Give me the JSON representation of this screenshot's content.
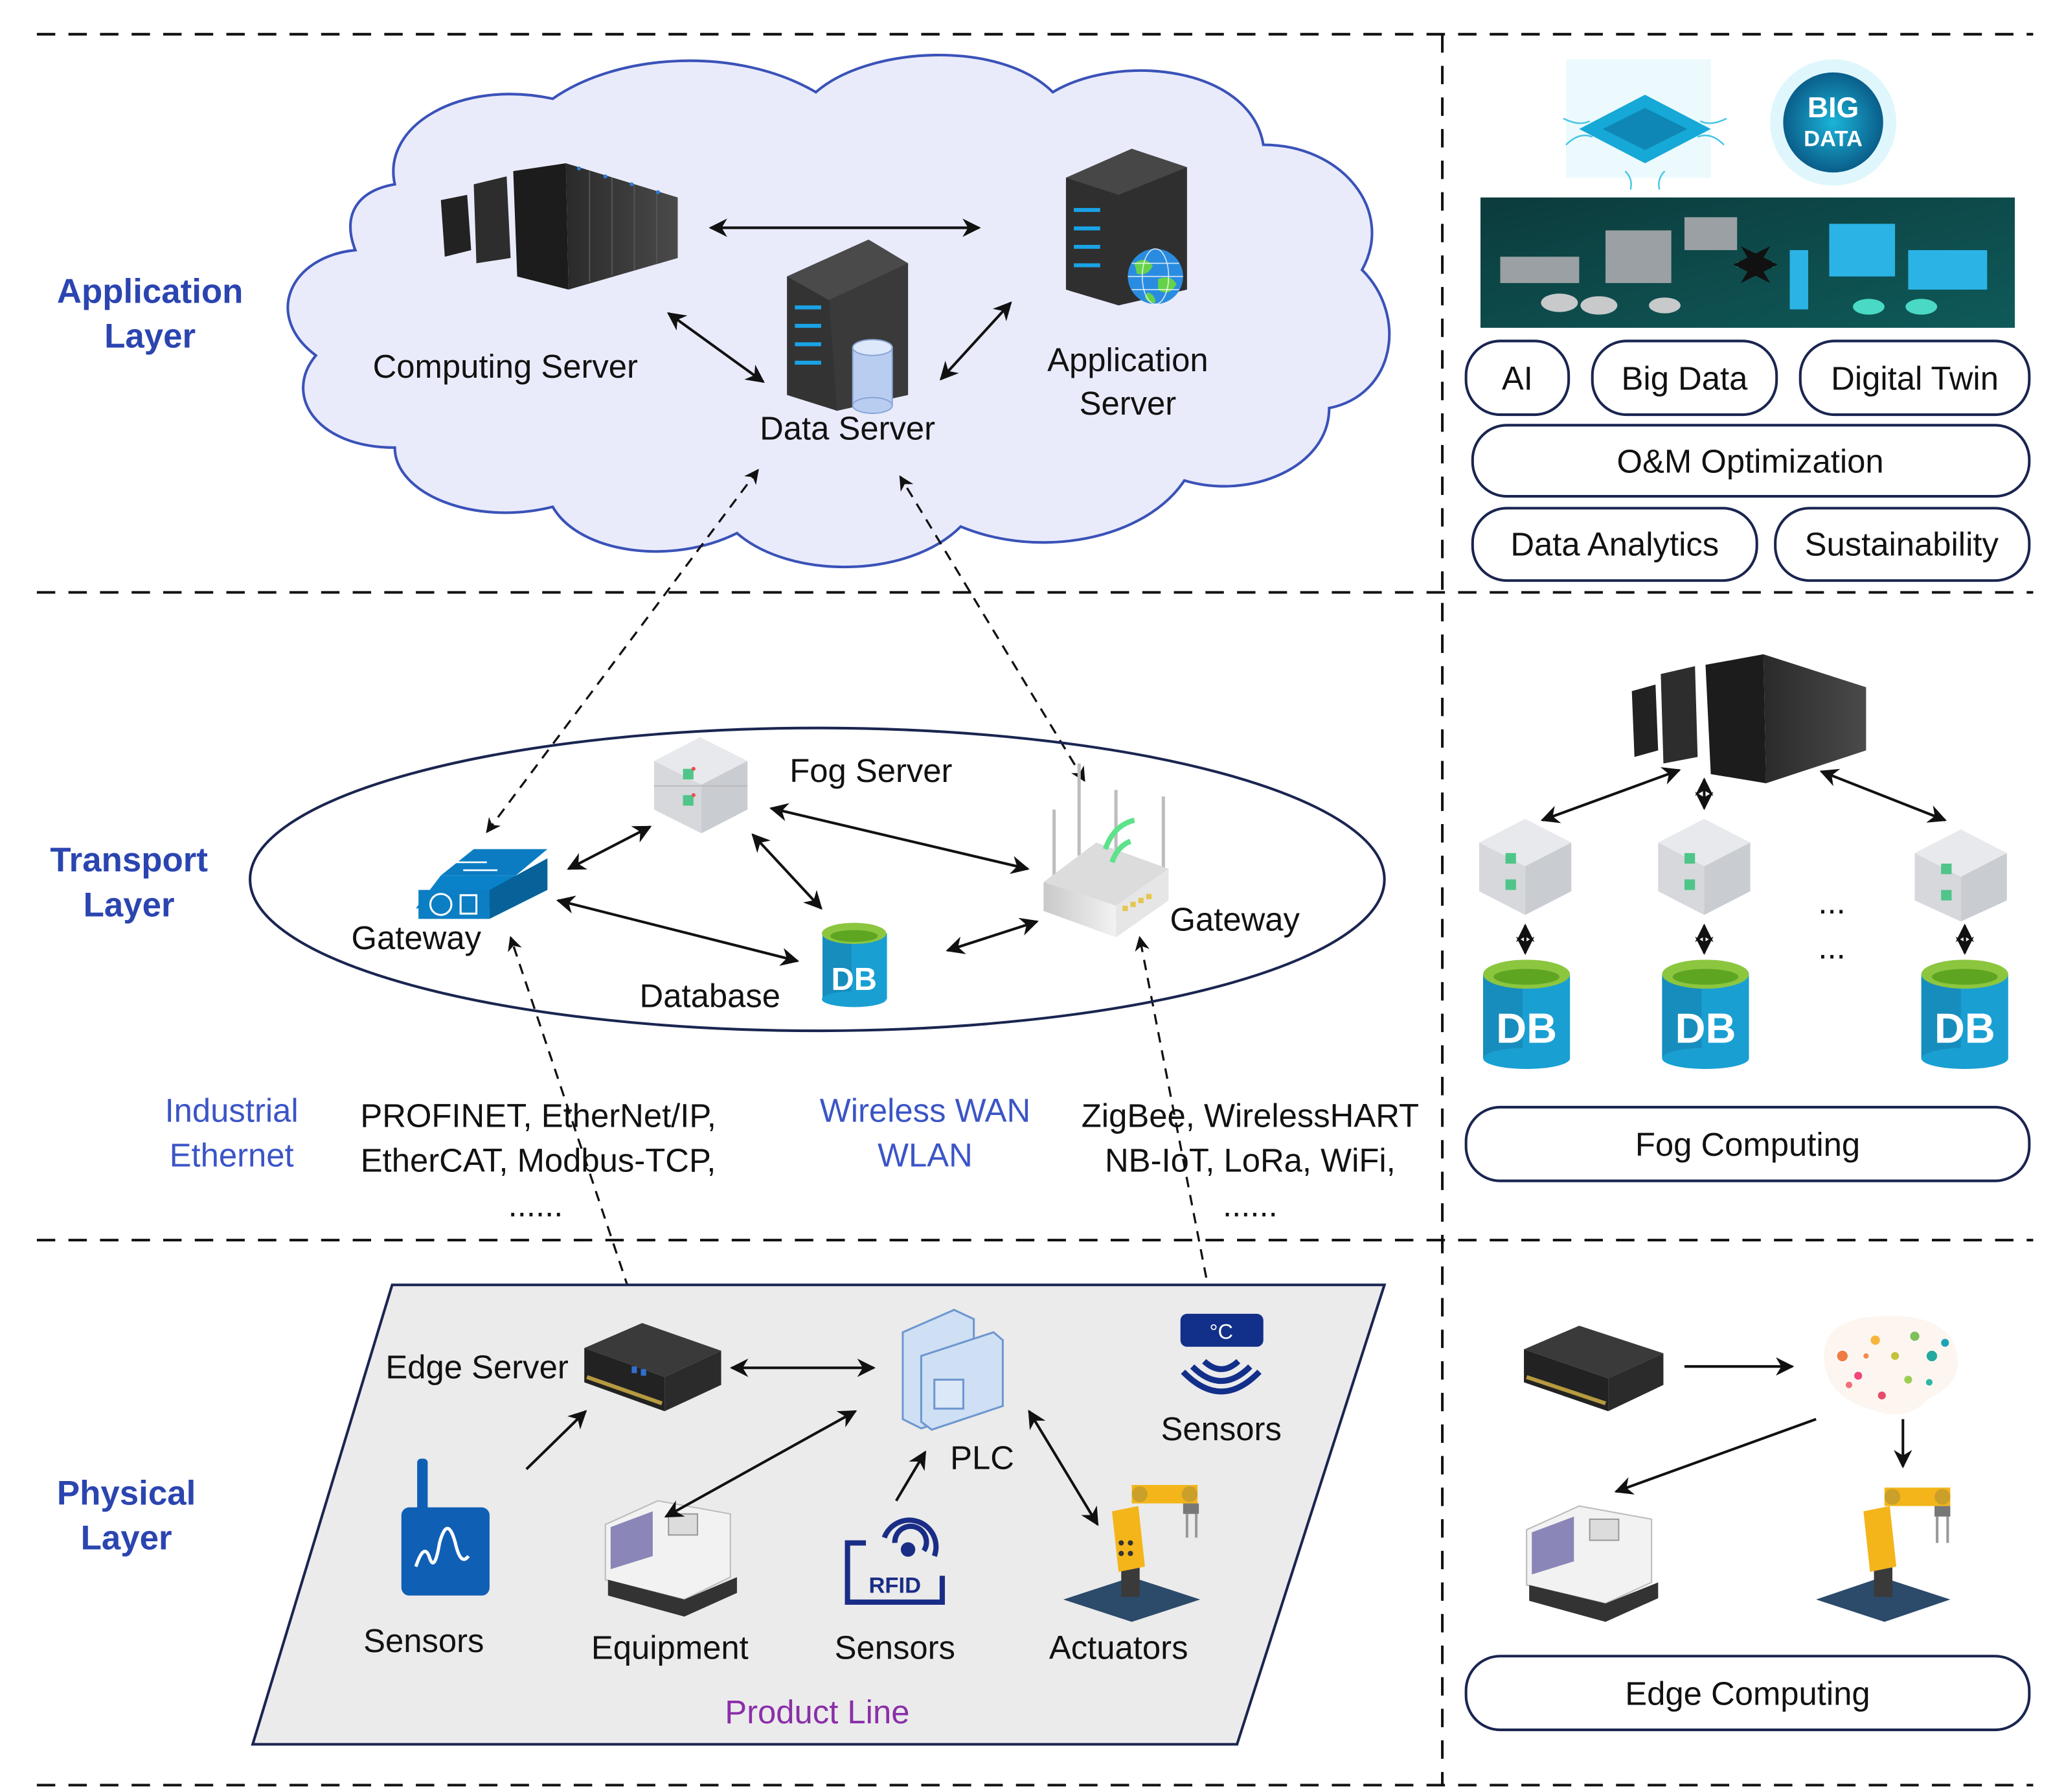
{
  "colors": {
    "layer_label": "#2b45b0",
    "network_label": "#3b55c6",
    "product_line": "#8a2fa8",
    "cloud_fill": "#e9ebfb",
    "cloud_stroke": "#3a52b8",
    "product_fill": "#ebebeb",
    "outline": "#1a2550",
    "db_blue": "#1a9fd2",
    "db_lid": "#8cc63f",
    "sensor_blue": "#0f5fb5",
    "rfid_navy": "#1a2d86"
  },
  "layers": {
    "application": {
      "line1": "Application",
      "line2": "Layer"
    },
    "transport": {
      "line1": "Transport",
      "line2": "Layer"
    },
    "physical": {
      "line1": "Physical",
      "line2": "Layer"
    }
  },
  "application_layer": {
    "computing_server": "Computing Server",
    "data_server": "Data Server",
    "application_server_line1": "Application",
    "application_server_line2": "Server"
  },
  "transport_layer": {
    "fog_server": "Fog Server",
    "gateway_left": "Gateway",
    "gateway_right": "Gateway",
    "database": "Database",
    "db_icon_text": "DB"
  },
  "networks": {
    "industrial_line1": "Industrial",
    "industrial_line2": "Ethernet",
    "industrial_protocols_line1": "PROFINET, EtherNet/IP,",
    "industrial_protocols_line2": "EtherCAT, Modbus-TCP,",
    "industrial_more": "......",
    "wireless_line1": "Wireless WAN",
    "wireless_line2": "WLAN",
    "wireless_protocols_line1": "ZigBee, WirelessHART",
    "wireless_protocols_line2": "NB-IoT, LoRa, WiFi,",
    "wireless_more": "......"
  },
  "physical_layer": {
    "edge_server": "Edge Server",
    "plc": "PLC",
    "sensors_temp": "Sensors",
    "temp_unit": "°C",
    "sensors_wave": "Sensors",
    "equipment": "Equipment",
    "sensors_rfid": "Sensors",
    "rfid_text": "RFID",
    "actuators": "Actuators",
    "product_line": "Product Line"
  },
  "right_panel": {
    "application": {
      "big_data_badge_line1": "BIG",
      "big_data_badge_line2": "DATA",
      "pills": [
        "AI",
        "Big Data",
        "Digital Twin",
        "O&M Optimization",
        "Data Analytics",
        "Sustainability"
      ]
    },
    "fog": {
      "db_icon_text": "DB",
      "ellipsis": "...",
      "caption": "Fog Computing"
    },
    "edge": {
      "caption": "Edge Computing"
    }
  }
}
